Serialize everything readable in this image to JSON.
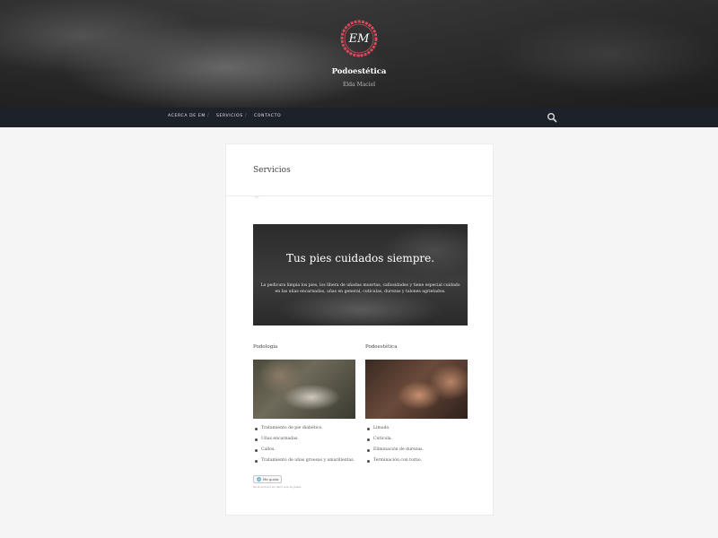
{
  "header": {
    "logo_text": "EM",
    "site_title": "Podoestética",
    "site_description": "Elda Maciel"
  },
  "nav": {
    "items": [
      "Acerca de EM",
      "Servicios",
      "Contacto"
    ],
    "separator": "/",
    "search_icon": "search-icon"
  },
  "page": {
    "title": "Servicios",
    "banner": {
      "heading": "Tus pies cuidados siempre.",
      "text": "La pedicura limpia los pies, los libera de uñadas muertas, callosidades y tiene especial cuidado en las uñas encarnadas, uñas en general, cutículas, durezas y talones agrietados."
    },
    "columns": [
      {
        "title": "Podología",
        "items": [
          "Tratamiento de pie diabético.",
          "Uñas encarnadas.",
          "Callos.",
          "Tratamiento de uñas gruesas y amarillentas."
        ]
      },
      {
        "title": "Podoestética",
        "items": [
          "Limado.",
          "Cutícula.",
          "Eliminación de durezas.",
          "Terminación con torno."
        ]
      }
    ],
    "like": {
      "button_label": "Me gusta",
      "note": "Sé el primero en decir que te gusta."
    }
  },
  "colors": {
    "nav_bg": "#1d212a",
    "logo_ring": "#d9475a",
    "page_bg": "#f5f5f5"
  }
}
